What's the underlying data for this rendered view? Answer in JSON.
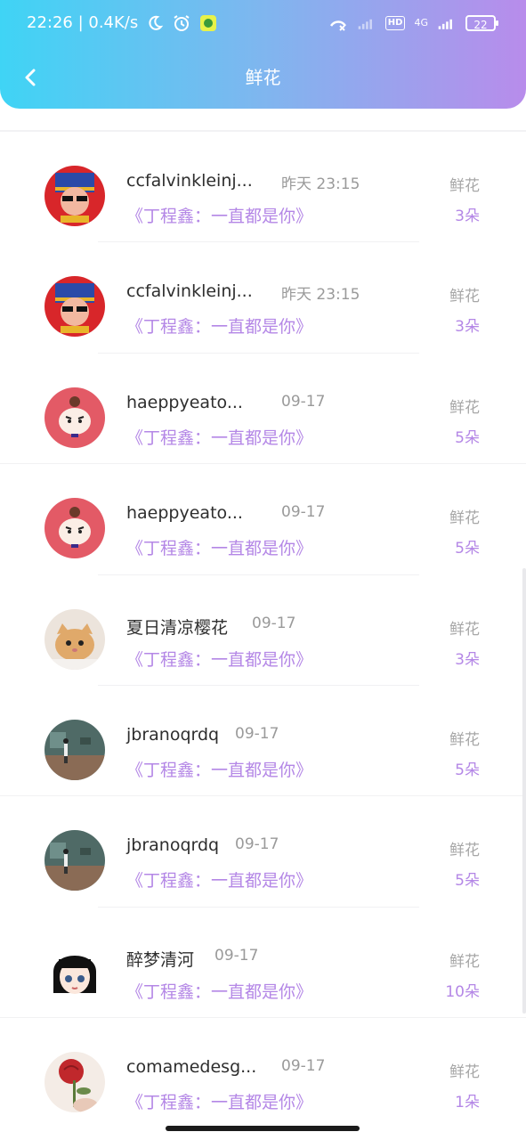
{
  "status": {
    "time_speed": "22:26 | 0.4K/s",
    "hd": "HD",
    "network": "4G",
    "battery": "22"
  },
  "nav": {
    "title": "鲜花"
  },
  "gift_label": "鲜花",
  "items": [
    {
      "name": "ccfalvinkleinj...",
      "time": "昨天 23:15",
      "song": "《丁程鑫：一直都是你》",
      "count": "3朵",
      "avatar": "emperor"
    },
    {
      "name": "ccfalvinkleinj...",
      "time": "昨天 23:15",
      "song": "《丁程鑫：一直都是你》",
      "count": "3朵",
      "avatar": "emperor"
    },
    {
      "name": "haeppyeato...",
      "time": "09-17",
      "song": "《丁程鑫：一直都是你》",
      "count": "5朵",
      "avatar": "girl-red"
    },
    {
      "name": "haeppyeato...",
      "time": "09-17",
      "song": "《丁程鑫：一直都是你》",
      "count": "5朵",
      "avatar": "girl-red"
    },
    {
      "name": "夏日清凉樱花",
      "time": "09-17",
      "song": "《丁程鑫：一直都是你》",
      "count": "3朵",
      "avatar": "cat"
    },
    {
      "name": "jbranoqrdq",
      "time": "09-17",
      "song": "《丁程鑫：一直都是你》",
      "count": "5朵",
      "avatar": "scene"
    },
    {
      "name": "jbranoqrdq",
      "time": "09-17",
      "song": "《丁程鑫：一直都是你》",
      "count": "5朵",
      "avatar": "scene"
    },
    {
      "name": "醉梦清河",
      "time": "09-17",
      "song": "《丁程鑫：一直都是你》",
      "count": "10朵",
      "avatar": "anime-girl"
    },
    {
      "name": "comamedesg...",
      "time": "09-17",
      "song": "《丁程鑫：一直都是你》",
      "count": "1朵",
      "avatar": "rose"
    }
  ]
}
